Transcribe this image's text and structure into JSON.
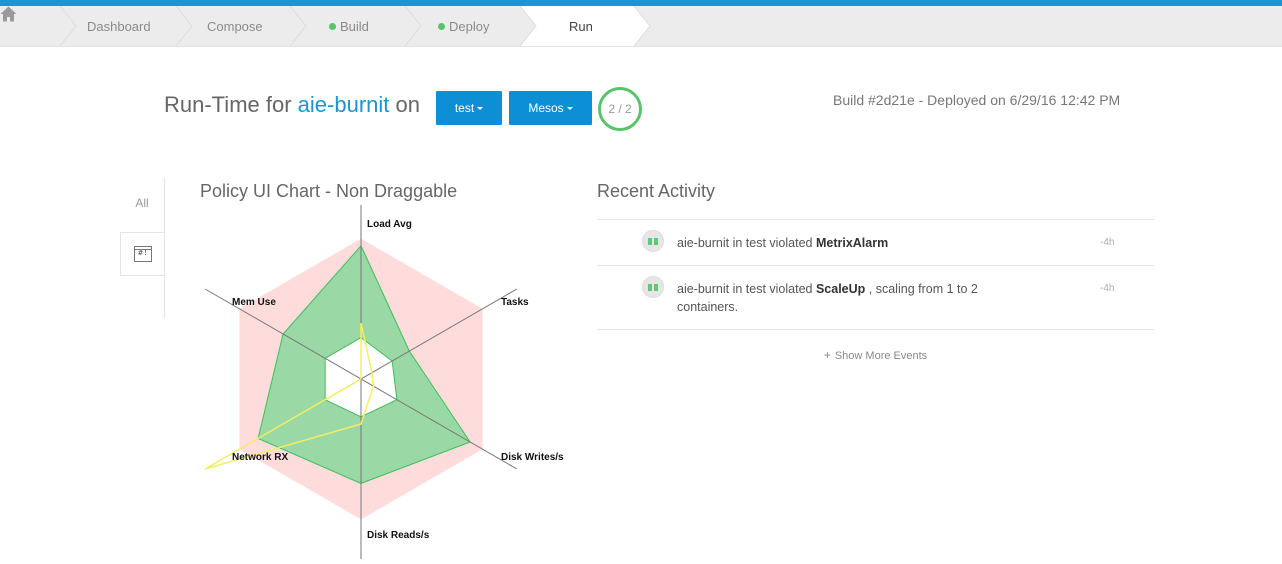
{
  "breadcrumbs": [
    {
      "label": "Dashboard",
      "status": null
    },
    {
      "label": "Compose",
      "status": null
    },
    {
      "label": "Build",
      "status": "ok"
    },
    {
      "label": "Deploy",
      "status": "ok"
    },
    {
      "label": "Run",
      "status": null,
      "active": true
    }
  ],
  "header": {
    "title_prefix": "Run-Time for",
    "app_name": "aie-burnit",
    "title_on": "on",
    "env_button": "test",
    "scheduler_button": "Mesos",
    "instances": "2 / 2",
    "build_info": "Build #2d21e - Deployed on 6/29/16 12:42 PM"
  },
  "side_tabs": {
    "all": "All",
    "alarm_icon_text": "#!"
  },
  "chart": {
    "title": "Policy UI Chart - Non Draggable"
  },
  "chart_data": {
    "type": "radar",
    "axes": [
      "Load Avg",
      "Tasks",
      "Disk Writes/s",
      "Disk Reads/s",
      "Network RX",
      "Mem Use"
    ],
    "scale_max": 1.0,
    "policy_band": {
      "inner": [
        0.28,
        0.28,
        0.28,
        0.28,
        0.28,
        0.28
      ],
      "outer": [
        0.78,
        0.78,
        0.78,
        0.78,
        0.78,
        0.78
      ]
    },
    "fill_range": {
      "outer": [
        0.74,
        0.31,
        0.7,
        0.58,
        0.66,
        0.5
      ],
      "inner": [
        0.23,
        0.2,
        0.23,
        0.21,
        0.23,
        0.23
      ]
    },
    "series": [
      {
        "values": [
          0.31,
          0.07,
          0.08,
          0.25,
          1.0,
          0.0
        ]
      }
    ],
    "colors": {
      "policy": "#ffdcdc",
      "fill": "#9ad9a6",
      "fill_stroke": "#3bbf5a",
      "series": "#f2ef62",
      "axis": "#777777"
    }
  },
  "activity": {
    "title": "Recent Activity",
    "items": [
      {
        "pre": "aie-burnit in test violated ",
        "strong": "MetrixAlarm",
        "post": "",
        "time": "-4h"
      },
      {
        "pre": "aie-burnit in test violated ",
        "strong": "ScaleUp",
        "post": " , scaling from 1 to 2 containers.",
        "time": "-4h"
      }
    ],
    "show_more": "Show More Events"
  },
  "colors": {
    "accent": "#1a95d6",
    "button": "#0d8fd6",
    "success": "#57c46a"
  }
}
